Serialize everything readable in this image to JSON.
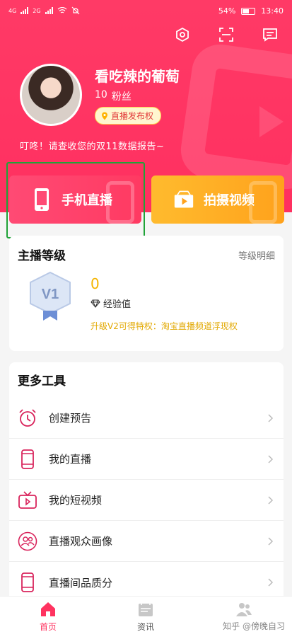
{
  "status_bar": {
    "network_left": "4G",
    "network_right": "2G",
    "battery": "54%",
    "time": "13:40"
  },
  "profile": {
    "username": "看吃辣的葡萄",
    "fans_count": "10",
    "fans_label": "粉丝",
    "badge": "直播发布权",
    "report_text": "叮咚！请查收您的双11数据报告~"
  },
  "actions": {
    "live": "手机直播",
    "video": "拍摄视频"
  },
  "level": {
    "title": "主播等级",
    "detail": "等级明细",
    "badge_text": "V1",
    "value": "0",
    "exp_label": "经验值",
    "privilege": "升级V2可得特权：淘宝直播频道浮现权"
  },
  "tools": {
    "title": "更多工具",
    "items": [
      {
        "label": "创建预告",
        "icon": "alarm-clock-icon"
      },
      {
        "label": "我的直播",
        "icon": "phone-icon"
      },
      {
        "label": "我的短视频",
        "icon": "tv-play-icon"
      },
      {
        "label": "直播观众画像",
        "icon": "audience-icon"
      },
      {
        "label": "直播间品质分",
        "icon": "phone-icon"
      }
    ]
  },
  "tabs": [
    {
      "label": "首页",
      "icon": "home-icon",
      "active": true
    },
    {
      "label": "资讯",
      "icon": "news-icon",
      "active": false
    },
    {
      "label": "",
      "icon": "people-icon",
      "active": false
    }
  ],
  "watermark": "知乎 @傍晚自习",
  "colors": {
    "brand": "#ff3360",
    "accent_yellow": "#ffa21c",
    "highlight_box": "#1fa338"
  }
}
